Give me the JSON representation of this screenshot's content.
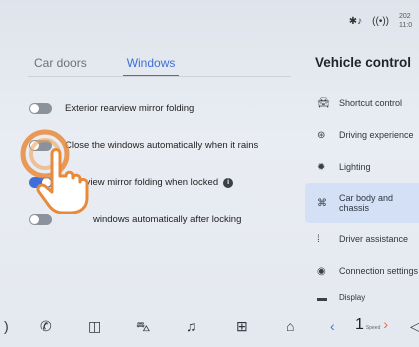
{
  "status": {
    "time_partial": "202 11:0",
    "icons": [
      "bluetooth-audio-icon",
      "signal-icon"
    ]
  },
  "tabs": [
    {
      "label": "Car doors",
      "active": false
    },
    {
      "label": "Windows",
      "active": true
    }
  ],
  "options": [
    {
      "label": "Exterior rearview mirror folding",
      "on": false
    },
    {
      "label": "Close the windows automatically when it rains",
      "on": false
    },
    {
      "label": "Rearview mirror folding when locked",
      "on": true,
      "info": true
    },
    {
      "label": "windows automatically after locking",
      "on": false
    }
  ],
  "panel": {
    "title": "Vehicle control",
    "items": [
      {
        "label": "Shortcut control",
        "icon": "car-icon"
      },
      {
        "label": "Driving experience",
        "icon": "steering-wheel-icon"
      },
      {
        "label": "Lighting",
        "icon": "light-icon"
      },
      {
        "label": "Car body and chassis",
        "icon": "chassis-icon",
        "selected": true
      },
      {
        "label": "Driver assistance",
        "icon": "lane-icon"
      },
      {
        "label": "Connection settings",
        "icon": "connection-icon"
      },
      {
        "label": "Display",
        "icon": "display-icon"
      }
    ]
  },
  "dock": {
    "speed_value": "1",
    "speed_label": "Speed"
  },
  "colors": {
    "accent": "#3e6fd8",
    "touch": "#e98a3a"
  }
}
